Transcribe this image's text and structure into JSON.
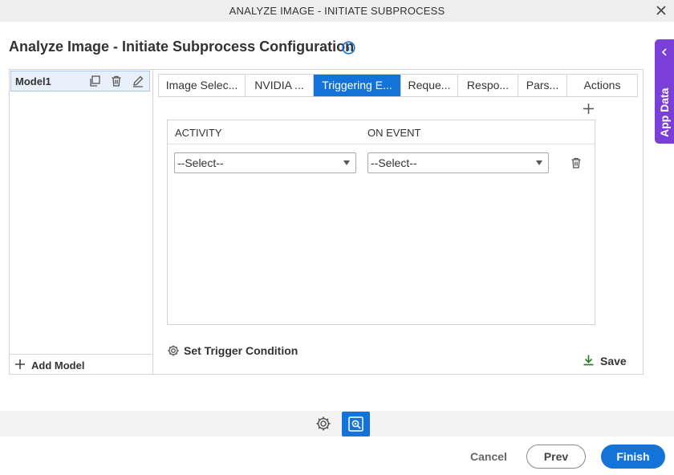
{
  "window": {
    "title": "ANALYZE IMAGE - INITIATE SUBPROCESS",
    "close_icon": "close-icon"
  },
  "page": {
    "heading": "Analyze Image - Initiate Subprocess Configuration",
    "info_icon": "info-icon"
  },
  "app_data_tab": {
    "label": "App Data",
    "icon": "chevron-left-icon",
    "color": "#7b3fd9"
  },
  "models": {
    "items": [
      {
        "name": "Model1"
      }
    ],
    "add_label": "Add Model"
  },
  "tabs": [
    {
      "label": "Image Selec..."
    },
    {
      "label": "NVIDIA ..."
    },
    {
      "label": "Triggering E...",
      "active": true
    },
    {
      "label": "Reque..."
    },
    {
      "label": "Respo..."
    },
    {
      "label": "Pars..."
    },
    {
      "label": "Actions"
    }
  ],
  "triggering": {
    "columns": {
      "activity": "ACTIVITY",
      "on_event": "ON EVENT"
    },
    "rows": [
      {
        "activity": "--Select--",
        "on_event": "--Select--"
      }
    ],
    "set_trigger_label": "Set Trigger Condition",
    "save_label": "Save"
  },
  "footer": {
    "cancel": "Cancel",
    "prev": "Prev",
    "finish": "Finish"
  },
  "colors": {
    "accent": "#1473d8",
    "app_data": "#7b3fd9",
    "save_icon": "#2e7d32"
  }
}
